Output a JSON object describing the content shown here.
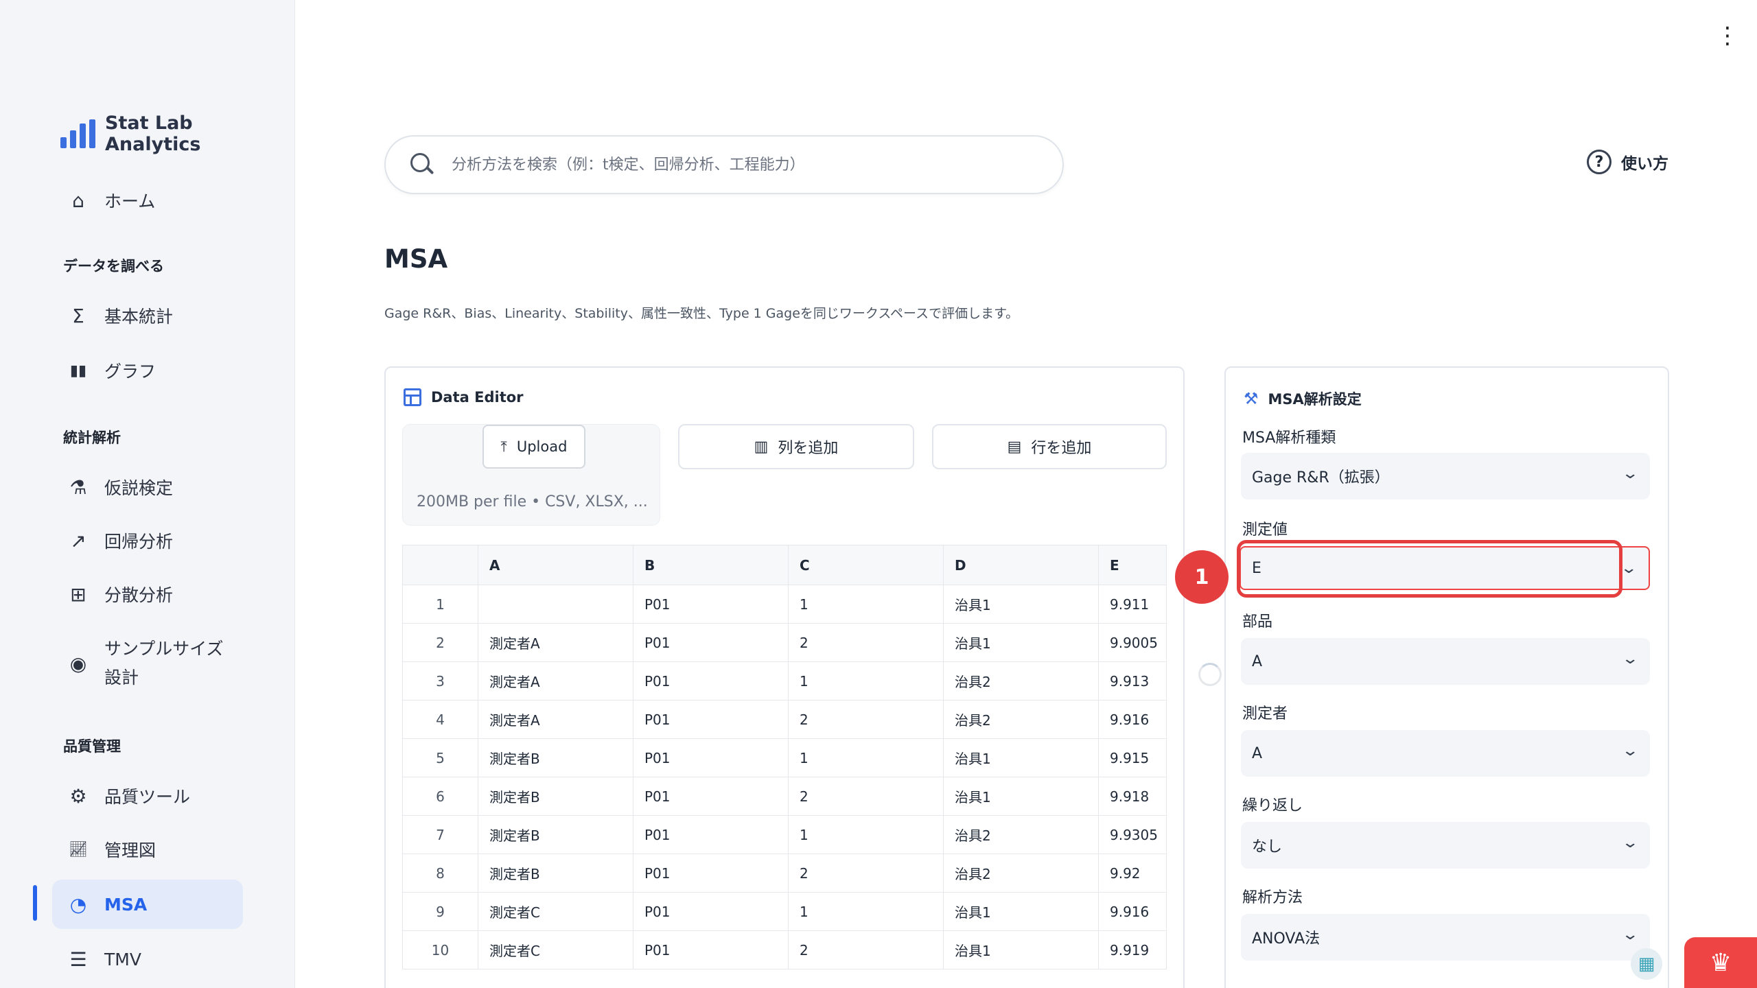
{
  "app": {
    "brand": "Stat Lab Analytics",
    "brand_color": "#3b6fe0",
    "accent_color": "#2563eb",
    "marker_color": "#e53e3e"
  },
  "sidebar": {
    "home": "ホーム",
    "section_explore": "データを調べる",
    "basic_stats": "基本統計",
    "graph": "グラフ",
    "section_analysis": "統計解析",
    "hypothesis": "仮説検定",
    "regression": "回帰分析",
    "anova": "分散分析",
    "sample_size_1": "サンプルサイズ",
    "sample_size_2": "設計",
    "section_quality": "品質管理",
    "quality_tools": "品質ツール",
    "control_chart": "管理図",
    "msa": "MSA",
    "tmv": "TMV"
  },
  "header": {
    "search_placeholder": "分析方法を検索（例：t検定、回帰分析、工程能力）",
    "help_label": "使い方"
  },
  "page": {
    "title": "MSA",
    "description": "Gage R&R、Bias、Linearity、Stability、属性一致性、Type 1 Gageを同じワークスペースで評価します。"
  },
  "data_editor": {
    "title": "Data Editor",
    "upload_label": "Upload",
    "upload_hint": "200MB per file • CSV, XLSX, ...",
    "add_column": "列を追加",
    "add_row": "行を追加",
    "columns": [
      "A",
      "B",
      "C",
      "D",
      "E"
    ],
    "rows": [
      {
        "idx": "1",
        "cells": [
          "",
          "P01",
          "1",
          "治具1",
          "9.911"
        ]
      },
      {
        "idx": "2",
        "cells": [
          "測定者A",
          "P01",
          "2",
          "治具1",
          "9.9005"
        ]
      },
      {
        "idx": "3",
        "cells": [
          "測定者A",
          "P01",
          "1",
          "治具2",
          "9.913"
        ]
      },
      {
        "idx": "4",
        "cells": [
          "測定者A",
          "P01",
          "2",
          "治具2",
          "9.916"
        ]
      },
      {
        "idx": "5",
        "cells": [
          "測定者B",
          "P01",
          "1",
          "治具1",
          "9.915"
        ]
      },
      {
        "idx": "6",
        "cells": [
          "測定者B",
          "P01",
          "2",
          "治具1",
          "9.918"
        ]
      },
      {
        "idx": "7",
        "cells": [
          "測定者B",
          "P01",
          "1",
          "治具2",
          "9.9305"
        ]
      },
      {
        "idx": "8",
        "cells": [
          "測定者B",
          "P01",
          "2",
          "治具2",
          "9.92"
        ]
      },
      {
        "idx": "9",
        "cells": [
          "測定者C",
          "P01",
          "1",
          "治具1",
          "9.916"
        ]
      },
      {
        "idx": "10",
        "cells": [
          "測定者C",
          "P01",
          "2",
          "治具1",
          "9.919"
        ]
      }
    ]
  },
  "msa_settings": {
    "title": "MSA解析設定",
    "analysis_type_label": "MSA解析種類",
    "analysis_type_value": "Gage R&R（拡張）",
    "measurement_label": "測定値",
    "measurement_value": "E",
    "part_label": "部品",
    "part_value": "A",
    "operator_label": "測定者",
    "operator_value": "A",
    "repeat_label": "繰り返し",
    "repeat_value": "なし",
    "method_label": "解析方法",
    "method_value": "ANOVA法"
  },
  "annotation": {
    "marker_number": "1"
  }
}
